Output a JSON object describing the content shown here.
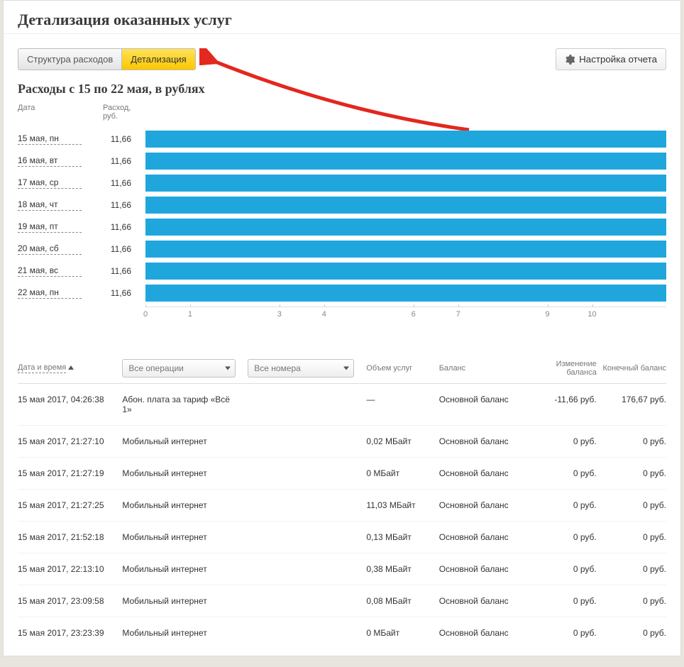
{
  "header": {
    "title": "Детализация оказанных услуг"
  },
  "toolbar": {
    "tab_structure": "Структура расходов",
    "tab_details": "Детализация",
    "report_settings": "Настройка отчета"
  },
  "chart_section": {
    "subtitle": "Расходы с 15 по 22 мая, в рублях",
    "col_date": "Дата",
    "col_expense": "Расход, руб."
  },
  "chart_data": {
    "type": "bar",
    "title": "Расходы с 15 по 22 мая, в рублях",
    "xlabel": "Расход, руб.",
    "ylabel": "Дата",
    "xlim": [
      0,
      11.66
    ],
    "ticks": [
      0,
      1,
      3,
      4,
      6,
      7,
      9,
      10
    ],
    "categories": [
      "15 мая, пн",
      "16 мая, вт",
      "17 мая, ср",
      "18 мая, чт",
      "19 мая, пт",
      "20 мая, сб",
      "21 мая, вс",
      "22 мая, пн"
    ],
    "values": [
      11.66,
      11.66,
      11.66,
      11.66,
      11.66,
      11.66,
      11.66,
      11.66
    ],
    "value_labels": [
      "11,66",
      "11,66",
      "11,66",
      "11,66",
      "11,66",
      "11,66",
      "11,66",
      "11,66"
    ]
  },
  "table": {
    "headers": {
      "datetime": "Дата и время",
      "operations_select": "Все операции",
      "numbers_select": "Все номера",
      "volume": "Объем услуг",
      "balance": "Баланс",
      "balance_change": "Изменение баланса",
      "end_balance": "Конечный баланс"
    },
    "rows": [
      {
        "dt": "15 мая 2017, 04:26:38",
        "op": "Абон. плата за тариф «Всё 1»",
        "vol": "—",
        "bal": "Основной баланс",
        "chg": "-11,66 руб.",
        "end": "176,67 руб."
      },
      {
        "dt": "15 мая 2017, 21:27:10",
        "op": "Мобильный интернет",
        "vol": "0,02 МБайт",
        "bal": "Основной баланс",
        "chg": "0 руб.",
        "end": "0 руб."
      },
      {
        "dt": "15 мая 2017, 21:27:19",
        "op": "Мобильный интернет",
        "vol": "0 МБайт",
        "bal": "Основной баланс",
        "chg": "0 руб.",
        "end": "0 руб."
      },
      {
        "dt": "15 мая 2017, 21:27:25",
        "op": "Мобильный интернет",
        "vol": "11,03 МБайт",
        "bal": "Основной баланс",
        "chg": "0 руб.",
        "end": "0 руб."
      },
      {
        "dt": "15 мая 2017, 21:52:18",
        "op": "Мобильный интернет",
        "vol": "0,13 МБайт",
        "bal": "Основной баланс",
        "chg": "0 руб.",
        "end": "0 руб."
      },
      {
        "dt": "15 мая 2017, 22:13:10",
        "op": "Мобильный интернет",
        "vol": "0,38 МБайт",
        "bal": "Основной баланс",
        "chg": "0 руб.",
        "end": "0 руб."
      },
      {
        "dt": "15 мая 2017, 23:09:58",
        "op": "Мобильный интернет",
        "vol": "0,08 МБайт",
        "bal": "Основной баланс",
        "chg": "0 руб.",
        "end": "0 руб."
      },
      {
        "dt": "15 мая 2017, 23:23:39",
        "op": "Мобильный интернет",
        "vol": "0 МБайт",
        "bal": "Основной баланс",
        "chg": "0 руб.",
        "end": "0 руб."
      }
    ]
  }
}
